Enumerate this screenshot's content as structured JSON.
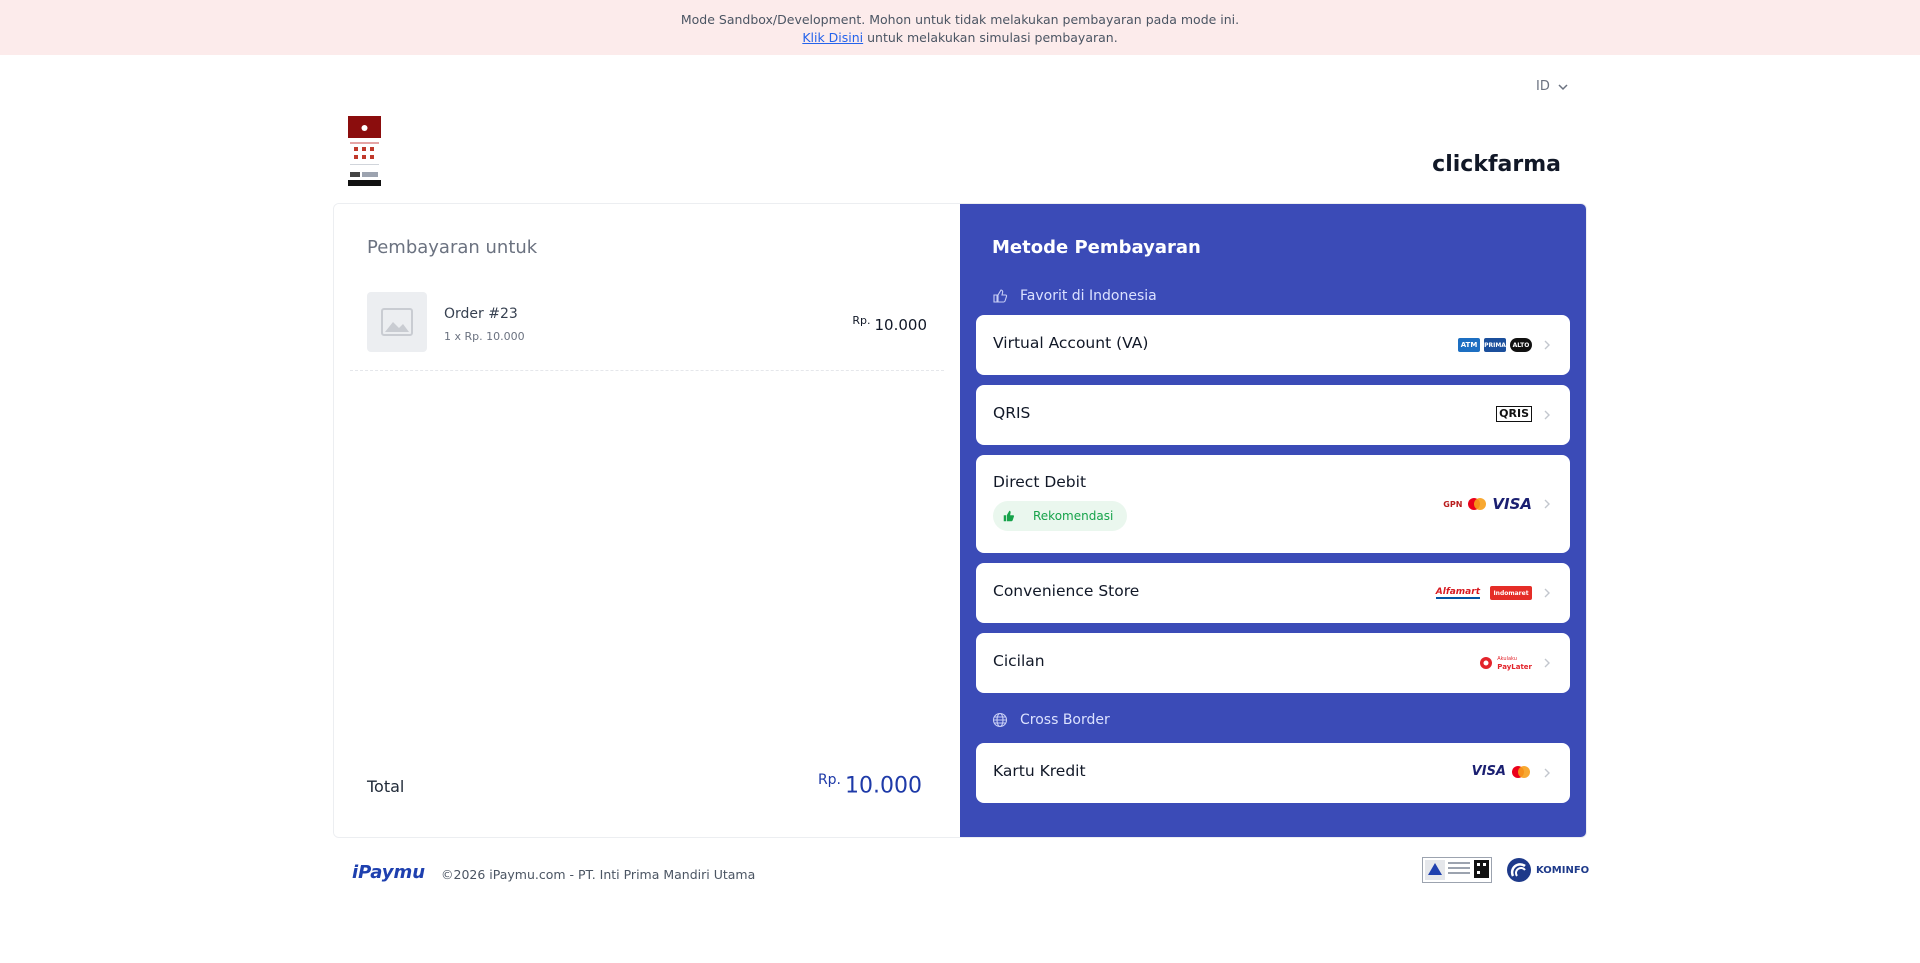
{
  "banner": {
    "line1": "Mode Sandbox/Development. Mohon untuk tidak melakukan pembayaran pada mode ini.",
    "link": "Klik Disini",
    "line2_rest": " untuk melakukan simulasi pembayaran."
  },
  "language": {
    "code": "ID"
  },
  "merchant": {
    "name": "clickfarma"
  },
  "order": {
    "section_title": "Pembayaran untuk",
    "item_name": "Order #23",
    "item_qty": "1 x Rp. 10.000",
    "currency": "Rp.",
    "item_price": "10.000",
    "total_label": "Total",
    "total_value": "10.000"
  },
  "methods": {
    "title": "Metode Pembayaran",
    "section_favorite": "Favorit di Indonesia",
    "section_cross_border": "Cross Border",
    "items": [
      {
        "label": "Virtual Account (VA)"
      },
      {
        "label": "QRIS"
      },
      {
        "label": "Direct Debit",
        "badge": "Rekomendasi"
      },
      {
        "label": "Convenience Store"
      },
      {
        "label": "Cicilan"
      },
      {
        "label": "Kartu Kredit"
      }
    ],
    "logo_text": {
      "atm": "ATM",
      "prima": "PRIMA",
      "alto": "ALTO",
      "qris": "QRIS",
      "gpn": "GPN",
      "visa": "VISA",
      "alfamart": "Alfamart",
      "indomaret": "Indomaret",
      "paylater": "PayLater",
      "akulaku": "Akulaku"
    }
  },
  "footer": {
    "brand": "iPaymu",
    "copyright": "©2026 iPaymu.com - PT. Inti Prima Mandiri Utama",
    "kominfo": "KOMINFO"
  },
  "colors": {
    "accent": "#3b4bb7",
    "total": "#1e3aa8",
    "banner_bg": "#fcebeb",
    "recommend": "#16a34a"
  }
}
